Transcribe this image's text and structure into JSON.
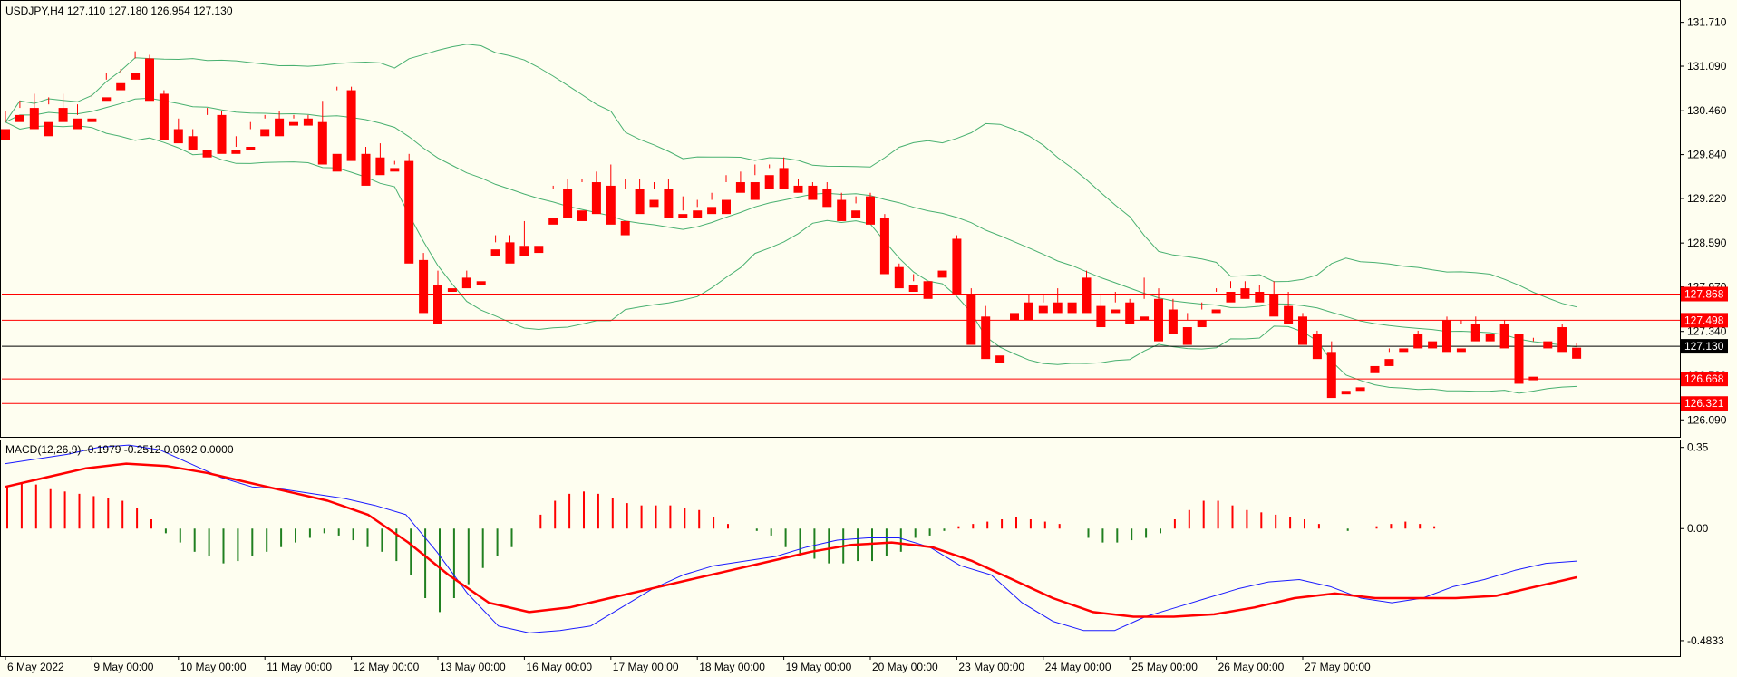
{
  "header": {
    "symbol": "USDJPY,H4",
    "open": "127.110",
    "high": "127.180",
    "low": "126.954",
    "close": "127.130"
  },
  "macd_header": {
    "label": "MACD(12,26,9)",
    "values": "-0.1979 -0.2512 0.0692 0.0000"
  },
  "colors": {
    "background": "#fefef0",
    "bull": "#2e7d4f",
    "bear": "#ff0000",
    "bands": "#48b070",
    "level": "#ff0000",
    "price_line": "#000000",
    "macd_line": "#1a1aff",
    "signal_line": "#ff0000",
    "hist_pos": "#ff0000",
    "hist_neg": "#208020"
  },
  "chart_data": [
    {
      "type": "candlestick",
      "name": "USDJPY H4",
      "ylim": [
        125.85,
        132.0
      ],
      "y_ticks": [
        "131.710",
        "131.090",
        "130.460",
        "129.840",
        "129.220",
        "128.590",
        "127.970",
        "127.340",
        "126.720",
        "126.090"
      ],
      "x_labels": [
        "6 May 2022",
        "9 May 00:00",
        "10 May 00:00",
        "11 May 00:00",
        "12 May 00:00",
        "13 May 00:00",
        "16 May 00:00",
        "17 May 00:00",
        "18 May 00:00",
        "19 May 00:00",
        "20 May 00:00",
        "23 May 00:00",
        "24 May 00:00",
        "25 May 00:00",
        "26 May 00:00",
        "27 May 00:00"
      ],
      "levels": [
        {
          "label": "127.868",
          "value": 127.868
        },
        {
          "label": "127.498",
          "value": 127.498
        },
        {
          "label": "126.668",
          "value": 126.668
        },
        {
          "label": "126.321",
          "value": 126.321
        }
      ],
      "current_price": {
        "label": "127.130",
        "value": 127.13
      },
      "candles": [
        [
          130.2,
          130.45,
          130.3,
          130.05
        ],
        [
          130.4,
          130.6,
          130.5,
          130.3
        ],
        [
          130.5,
          130.7,
          130.4,
          130.2
        ],
        [
          130.3,
          130.65,
          130.55,
          130.1
        ],
        [
          130.5,
          130.7,
          130.35,
          130.3
        ],
        [
          130.35,
          130.55,
          130.4,
          130.2
        ],
        [
          130.35,
          130.7,
          130.65,
          130.3
        ],
        [
          130.65,
          131.0,
          130.9,
          130.6
        ],
        [
          130.85,
          131.05,
          131.0,
          130.75
        ],
        [
          131.0,
          131.3,
          131.2,
          130.9
        ],
        [
          131.2,
          131.25,
          130.75,
          130.6
        ],
        [
          130.7,
          130.75,
          130.2,
          130.05
        ],
        [
          130.2,
          130.35,
          130.1,
          130.0
        ],
        [
          130.1,
          130.2,
          129.95,
          129.9
        ],
        [
          129.9,
          130.5,
          130.4,
          129.8
        ],
        [
          130.4,
          130.45,
          129.9,
          129.85
        ],
        [
          129.9,
          130.1,
          129.95,
          129.85
        ],
        [
          129.95,
          130.3,
          130.2,
          129.9
        ],
        [
          130.2,
          130.4,
          130.35,
          130.1
        ],
        [
          130.35,
          130.45,
          130.25,
          130.1
        ],
        [
          130.3,
          130.4,
          130.35,
          130.25
        ],
        [
          130.35,
          130.4,
          130.3,
          130.25
        ],
        [
          130.3,
          130.6,
          129.85,
          129.7
        ],
        [
          129.85,
          130.8,
          130.75,
          129.6
        ],
        [
          130.75,
          130.8,
          129.85,
          129.75
        ],
        [
          129.85,
          129.95,
          129.8,
          129.4
        ],
        [
          129.8,
          130.0,
          129.65,
          129.55
        ],
        [
          129.65,
          129.75,
          129.7,
          129.6
        ],
        [
          129.75,
          129.85,
          128.35,
          128.3
        ],
        [
          128.35,
          128.45,
          128.0,
          127.6
        ],
        [
          128.0,
          128.2,
          127.95,
          127.45
        ],
        [
          127.95,
          128.1,
          128.1,
          127.9
        ],
        [
          128.1,
          128.2,
          128.0,
          127.95
        ],
        [
          128.05,
          128.5,
          128.5,
          128.0
        ],
        [
          128.5,
          128.7,
          128.6,
          128.4
        ],
        [
          128.6,
          128.7,
          128.55,
          128.3
        ],
        [
          128.55,
          128.9,
          128.55,
          128.4
        ],
        [
          128.55,
          128.95,
          128.95,
          128.45
        ],
        [
          128.95,
          129.4,
          129.35,
          128.85
        ],
        [
          129.35,
          129.5,
          129.05,
          128.95
        ],
        [
          129.05,
          129.5,
          129.45,
          128.9
        ],
        [
          129.45,
          129.6,
          129.4,
          129.0
        ],
        [
          129.4,
          129.7,
          128.9,
          128.85
        ],
        [
          128.9,
          129.5,
          129.35,
          128.7
        ],
        [
          129.35,
          129.5,
          129.2,
          129.0
        ],
        [
          129.2,
          129.45,
          129.35,
          129.1
        ],
        [
          129.35,
          129.5,
          129.0,
          128.95
        ],
        [
          129.0,
          129.25,
          129.05,
          128.95
        ],
        [
          129.05,
          129.2,
          129.1,
          128.95
        ],
        [
          129.1,
          129.3,
          129.2,
          129.0
        ],
        [
          129.2,
          129.55,
          129.45,
          129.0
        ],
        [
          129.45,
          129.6,
          129.45,
          129.3
        ],
        [
          129.45,
          129.7,
          129.55,
          129.2
        ],
        [
          129.55,
          129.7,
          129.65,
          129.35
        ],
        [
          129.65,
          129.8,
          129.4,
          129.35
        ],
        [
          129.4,
          129.5,
          129.4,
          129.3
        ],
        [
          129.4,
          129.45,
          129.35,
          129.2
        ],
        [
          129.35,
          129.45,
          129.2,
          129.1
        ],
        [
          129.2,
          129.3,
          129.05,
          128.9
        ],
        [
          129.05,
          129.15,
          129.25,
          128.95
        ],
        [
          129.25,
          129.3,
          128.95,
          128.85
        ],
        [
          128.95,
          129.0,
          128.25,
          128.15
        ],
        [
          128.25,
          128.3,
          128.0,
          127.95
        ],
        [
          128.0,
          128.15,
          128.05,
          127.9
        ],
        [
          128.05,
          128.2,
          128.2,
          127.8
        ],
        [
          128.2,
          128.65,
          128.65,
          128.1
        ],
        [
          128.65,
          128.7,
          127.85,
          127.85
        ],
        [
          127.85,
          127.95,
          127.55,
          127.15
        ],
        [
          127.55,
          127.7,
          127.0,
          126.95
        ],
        [
          127.0,
          127.6,
          127.6,
          126.9
        ],
        [
          127.6,
          127.75,
          127.75,
          127.5
        ],
        [
          127.75,
          127.85,
          127.7,
          127.5
        ],
        [
          127.7,
          127.85,
          127.75,
          127.6
        ],
        [
          127.75,
          127.95,
          127.75,
          127.6
        ],
        [
          127.75,
          128.1,
          128.1,
          127.6
        ],
        [
          128.1,
          128.2,
          127.7,
          127.6
        ],
        [
          127.7,
          127.85,
          127.65,
          127.4
        ],
        [
          127.65,
          127.9,
          127.75,
          127.6
        ],
        [
          127.75,
          127.8,
          127.55,
          127.45
        ],
        [
          127.55,
          128.1,
          127.8,
          127.5
        ],
        [
          127.8,
          127.95,
          127.65,
          127.2
        ],
        [
          127.65,
          127.8,
          127.4,
          127.3
        ],
        [
          127.4,
          127.6,
          127.5,
          127.15
        ],
        [
          127.5,
          127.75,
          127.65,
          127.4
        ],
        [
          127.65,
          127.95,
          127.9,
          127.6
        ],
        [
          127.9,
          128.05,
          127.95,
          127.75
        ],
        [
          127.95,
          128.05,
          127.9,
          127.8
        ],
        [
          127.9,
          128.0,
          127.85,
          127.75
        ],
        [
          127.85,
          128.05,
          127.7,
          127.55
        ],
        [
          127.7,
          127.9,
          127.55,
          127.45
        ],
        [
          127.55,
          127.6,
          127.3,
          127.15
        ],
        [
          127.3,
          127.35,
          127.05,
          126.95
        ],
        [
          127.05,
          127.2,
          126.5,
          126.4
        ],
        [
          126.5,
          126.55,
          126.55,
          126.45
        ],
        [
          126.55,
          126.85,
          126.85,
          126.5
        ],
        [
          126.85,
          126.95,
          126.95,
          126.75
        ],
        [
          126.95,
          127.05,
          127.1,
          126.85
        ],
        [
          127.1,
          127.3,
          127.3,
          127.05
        ],
        [
          127.3,
          127.35,
          127.2,
          127.1
        ],
        [
          127.2,
          127.5,
          127.5,
          127.1
        ],
        [
          127.5,
          127.55,
          127.1,
          127.05
        ],
        [
          127.1,
          127.5,
          127.45,
          127.05
        ],
        [
          127.45,
          127.55,
          127.3,
          127.2
        ],
        [
          127.3,
          127.45,
          127.45,
          127.2
        ],
        [
          127.45,
          127.5,
          127.3,
          127.1
        ],
        [
          127.3,
          127.4,
          126.7,
          126.6
        ],
        [
          126.7,
          127.25,
          127.2,
          126.65
        ],
        [
          127.2,
          127.4,
          127.4,
          127.1
        ],
        [
          127.4,
          127.45,
          127.15,
          127.05
        ],
        [
          127.11,
          127.18,
          127.13,
          126.954
        ]
      ]
    },
    {
      "type": "macd",
      "name": "MACD(12,26,9)",
      "ylim": [
        -0.55,
        0.38
      ],
      "y_ticks": [
        "0.35",
        "0.00",
        "-0.4833"
      ],
      "histogram": [
        0.18,
        0.2,
        0.19,
        0.17,
        0.16,
        0.15,
        0.14,
        0.13,
        0.12,
        0.09,
        0.04,
        -0.02,
        -0.06,
        -0.1,
        -0.12,
        -0.15,
        -0.14,
        -0.12,
        -0.1,
        -0.08,
        -0.06,
        -0.04,
        -0.02,
        -0.03,
        -0.05,
        -0.08,
        -0.1,
        -0.14,
        -0.2,
        -0.3,
        -0.36,
        -0.3,
        -0.24,
        -0.17,
        -0.12,
        -0.08,
        0.0,
        0.06,
        0.12,
        0.15,
        0.16,
        0.15,
        0.13,
        0.11,
        0.1,
        0.1,
        0.1,
        0.09,
        0.08,
        0.05,
        0.02,
        0.0,
        -0.01,
        -0.03,
        -0.08,
        -0.11,
        -0.13,
        -0.15,
        -0.15,
        -0.14,
        -0.14,
        -0.12,
        -0.1,
        -0.04,
        -0.03,
        -0.01,
        0.01,
        0.02,
        0.03,
        0.04,
        0.05,
        0.04,
        0.03,
        0.02,
        0.0,
        -0.04,
        -0.06,
        -0.06,
        -0.05,
        -0.04,
        -0.02,
        0.04,
        0.08,
        0.12,
        0.12,
        0.1,
        0.08,
        0.07,
        0.06,
        0.05,
        0.04,
        0.02,
        0.0,
        -0.01,
        0.0,
        0.01,
        0.02,
        0.03,
        0.02,
        0.01
      ],
      "macd_line": [
        0.28,
        0.3,
        0.32,
        0.35,
        0.36,
        0.34,
        0.28,
        0.22,
        0.18,
        0.17,
        0.15,
        0.13,
        0.1,
        0.06,
        -0.1,
        -0.28,
        -0.42,
        -0.45,
        -0.44,
        -0.42,
        -0.34,
        -0.26,
        -0.2,
        -0.16,
        -0.14,
        -0.12,
        -0.08,
        -0.05,
        -0.04,
        -0.04,
        -0.08,
        -0.16,
        -0.2,
        -0.32,
        -0.4,
        -0.44,
        -0.44,
        -0.38,
        -0.34,
        -0.3,
        -0.26,
        -0.23,
        -0.22,
        -0.25,
        -0.3,
        -0.32,
        -0.3,
        -0.25,
        -0.22,
        -0.18,
        -0.15,
        -0.14
      ],
      "signal_line": [
        0.18,
        0.22,
        0.26,
        0.28,
        0.27,
        0.24,
        0.2,
        0.16,
        0.12,
        0.06,
        -0.06,
        -0.2,
        -0.32,
        -0.36,
        -0.34,
        -0.3,
        -0.26,
        -0.22,
        -0.18,
        -0.14,
        -0.1,
        -0.07,
        -0.06,
        -0.08,
        -0.14,
        -0.22,
        -0.3,
        -0.36,
        -0.38,
        -0.38,
        -0.37,
        -0.34,
        -0.3,
        -0.28,
        -0.3,
        -0.3,
        -0.3,
        -0.29,
        -0.25,
        -0.21
      ]
    }
  ]
}
